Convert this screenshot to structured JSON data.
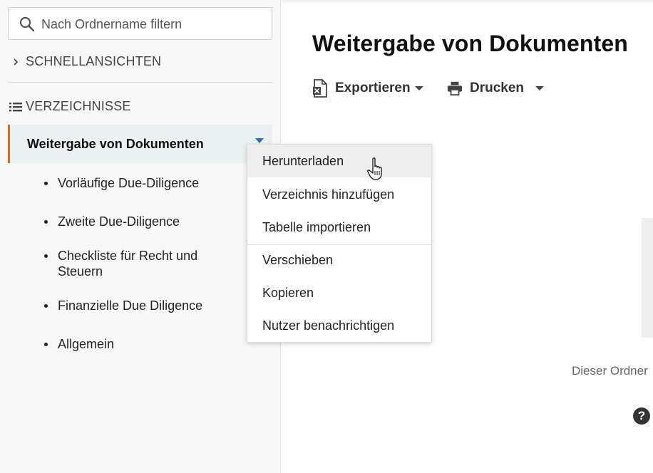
{
  "sidebar": {
    "search": {
      "placeholder": "Nach Ordnername filtern",
      "icon": "search-icon"
    },
    "quick_views": {
      "label": "SCHNELLANSICHTEN",
      "icon": "chevron-right-icon"
    },
    "directories": {
      "label": "VERZEICHNISSE",
      "icon": "list-icon"
    },
    "active_item": {
      "label": "Weitergabe von Dokumenten",
      "accent": "#d9681f"
    },
    "children": [
      "Vorläufige Due-Diligence",
      "Zweite Due-Diligence",
      "Checkliste für Recht und Steuern",
      "Finanzielle Due Diligence",
      "Allgemein"
    ]
  },
  "main": {
    "title": "Weitergabe von Dokumenten",
    "toolbar": {
      "export_label": "Exportieren",
      "print_label": "Drucken"
    },
    "empty_text": "Dieser Ordner",
    "help_label": "?"
  },
  "context_menu": {
    "items": [
      "Herunterladen",
      "Verzeichnis hinzufügen",
      "Tabelle importieren",
      "Verschieben",
      "Kopieren",
      "Nutzer benachrichtigen"
    ]
  }
}
